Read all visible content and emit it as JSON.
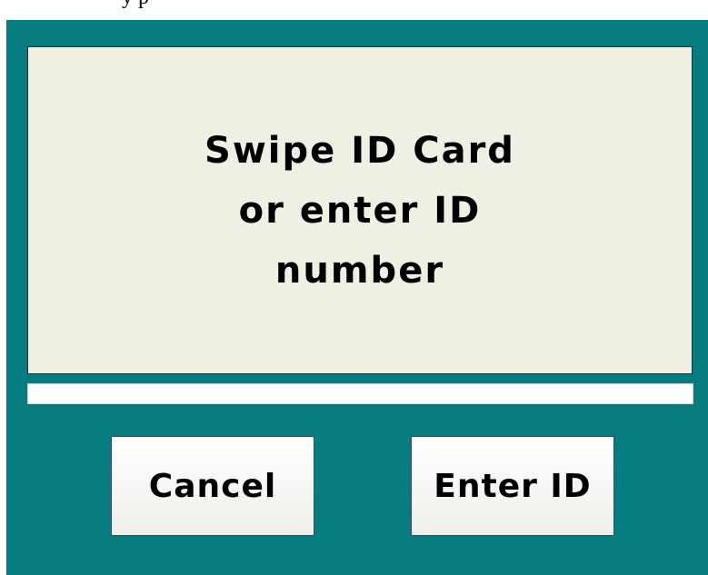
{
  "header": {
    "partial_text": "y                                    p"
  },
  "message": {
    "text": "Swipe ID Card\nor enter ID\nnumber"
  },
  "id_input": {
    "value": "",
    "placeholder": ""
  },
  "buttons": {
    "cancel_label": "Cancel",
    "enter_id_label": "Enter ID"
  },
  "colors": {
    "panel_background": "#047c80",
    "message_background": "#f0efe3",
    "button_background": "#f7f7f4",
    "text": "#000000"
  }
}
